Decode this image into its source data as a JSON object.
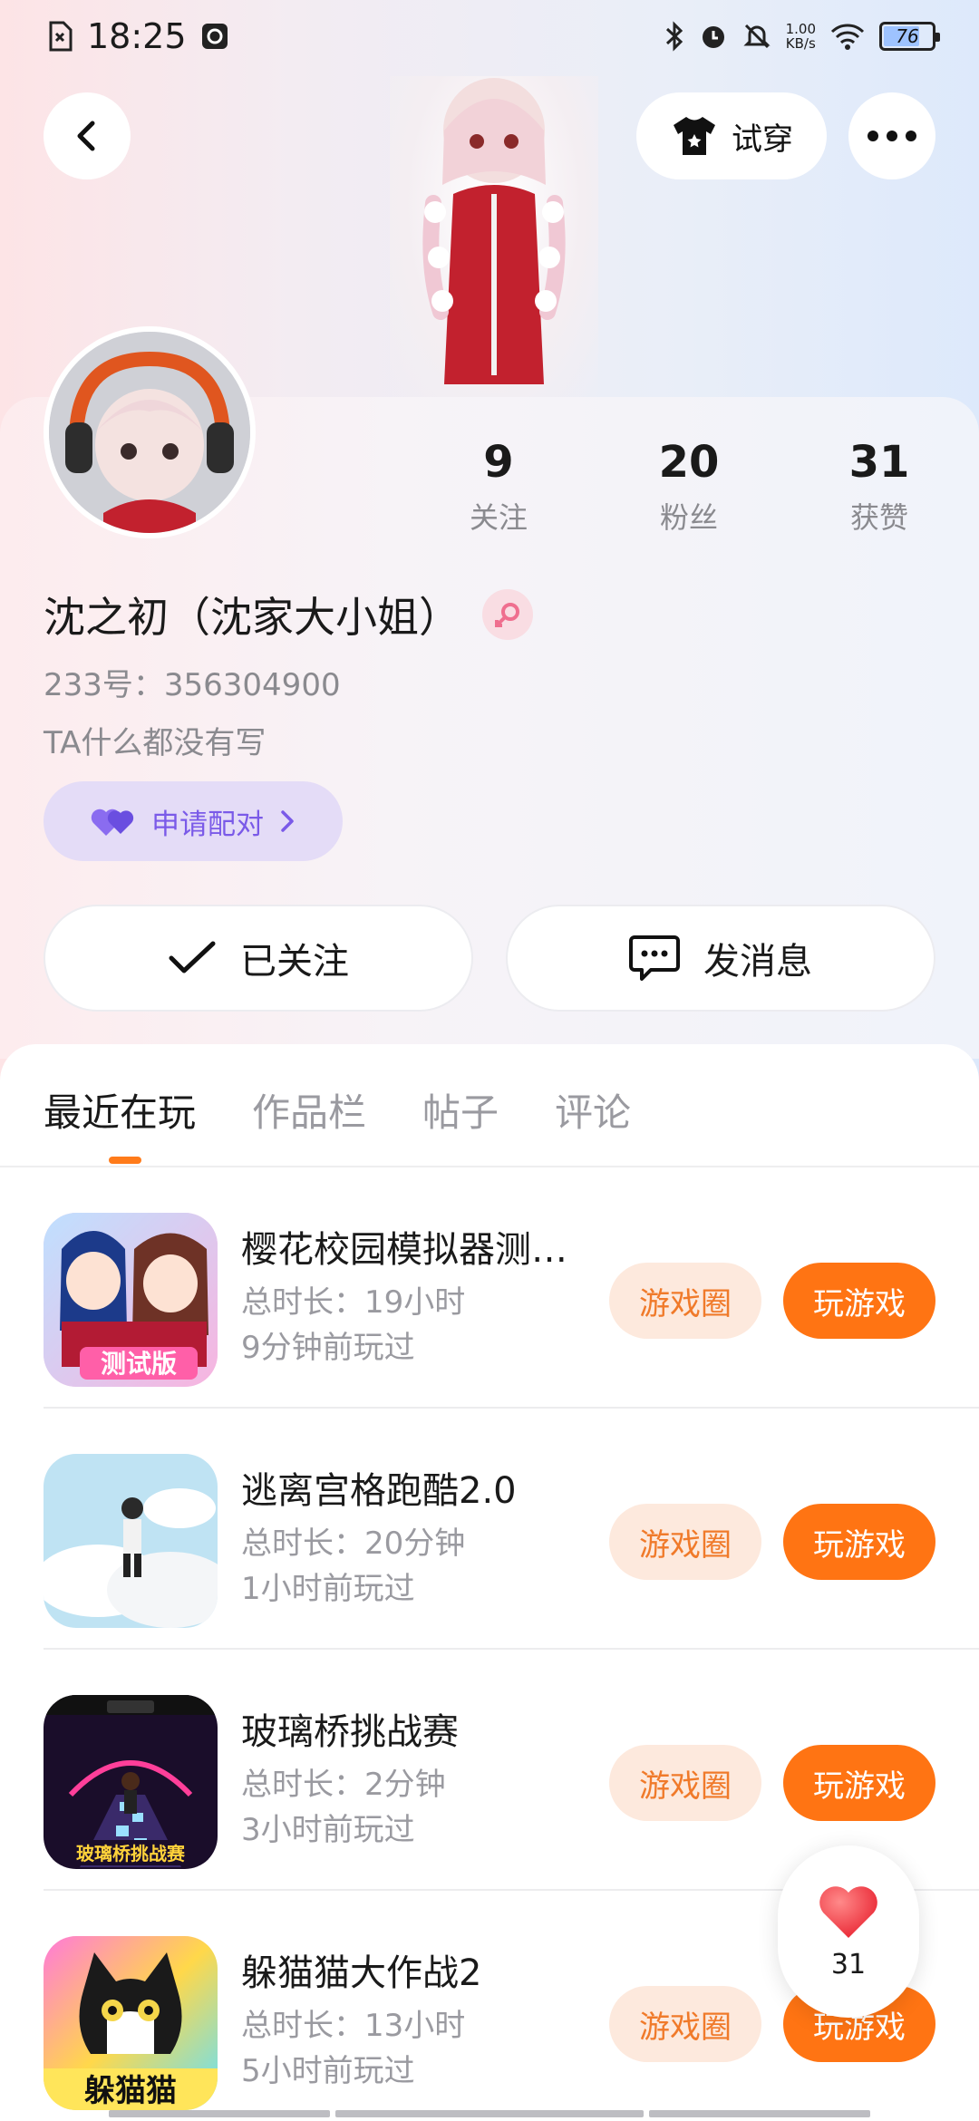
{
  "status_bar": {
    "time": "18:25",
    "net_speed_value": "1.00",
    "net_speed_unit": "KB/s",
    "battery": "76"
  },
  "header": {
    "try_on_label": "试穿"
  },
  "profile": {
    "stats": [
      {
        "value": "9",
        "label": "关注"
      },
      {
        "value": "20",
        "label": "粉丝"
      },
      {
        "value": "31",
        "label": "获赞"
      }
    ],
    "name": "沈之初（沈家大小姐）",
    "user_id": "233号：356304900",
    "bio": "TA什么都没有写",
    "pair_label": "申请配对",
    "follow_label": "已关注",
    "message_label": "发消息"
  },
  "tabs": [
    {
      "label": "最近在玩",
      "active": true
    },
    {
      "label": "作品栏",
      "active": false
    },
    {
      "label": "帖子",
      "active": false
    },
    {
      "label": "评论",
      "active": false
    }
  ],
  "games": [
    {
      "title": "樱花校园模拟器测试版",
      "duration": "总时长：19小时",
      "last_played": "9分钟前玩过",
      "icon_text": "测试版"
    },
    {
      "title": "逃离宫格跑酷2.0",
      "duration": "总时长：20分钟",
      "last_played": "1小时前玩过",
      "icon_text": ""
    },
    {
      "title": "玻璃桥挑战赛",
      "duration": "总时长：2分钟",
      "last_played": "3小时前玩过",
      "icon_text": "玻璃桥挑战赛"
    },
    {
      "title": "躲猫猫大作战2",
      "duration": "总时长：13小时",
      "last_played": "5小时前玩过",
      "icon_text": "躲猫猫"
    }
  ],
  "game_buttons": {
    "circle": "游戏圈",
    "play": "玩游戏"
  },
  "like_float": {
    "count": "31"
  },
  "colors": {
    "accent_orange": "#ff7413",
    "pair_purple": "#7a5ae8"
  }
}
